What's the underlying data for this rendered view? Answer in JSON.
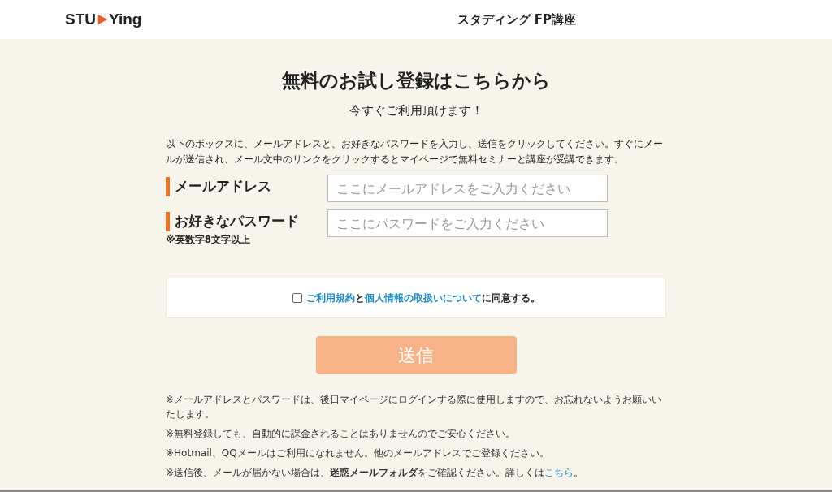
{
  "header": {
    "logo_left": "STU",
    "logo_right": "Ying",
    "title": "スタディング FP講座"
  },
  "form": {
    "title": "無料のお試し登録はこちらから",
    "subtitle": "今すぐご利用頂けます！",
    "intro": "以下のボックスに、メールアドレスと、お好きなパスワードを入力し、送信をクリックしてください。すぐにメールが送信され、メール文中のリンクをクリックするとマイページで無料セミナーと講座が受講できます。",
    "fields": [
      {
        "label": "メールアドレス",
        "placeholder": "ここにメールアドレスをご入力ください"
      },
      {
        "label": "お好きなパスワード",
        "note": "※英数字8文字以上",
        "placeholder": "ここにパスワードをご入力ください"
      }
    ],
    "agreement": {
      "checked": false,
      "parts": [
        {
          "kind": "link",
          "text": "ご利用規約"
        },
        {
          "kind": "text",
          "text": "と"
        },
        {
          "kind": "link",
          "text": "個人情報の取扱いについて"
        },
        {
          "kind": "text",
          "text": "に同意する。"
        }
      ]
    },
    "submit": {
      "label": "送信",
      "disabled": true
    },
    "notes": [
      {
        "text": "※メールアドレスとパスワードは、後日マイページにログインする際に使用しますので、お忘れないようお願いいたします。"
      },
      {
        "text": "※無料登録しても、自動的に課金されることはありませんのでご安心ください。"
      },
      {
        "text": "※Hotmail、QQメールはご利用になれません。他のメールアドレスでご登録ください。"
      },
      {
        "text": "※送信後、メールが届かない場合は、**迷惑メールフォルダ**をご確認ください。詳しくは",
        "link": "こちら",
        "tail": "。"
      }
    ]
  }
}
